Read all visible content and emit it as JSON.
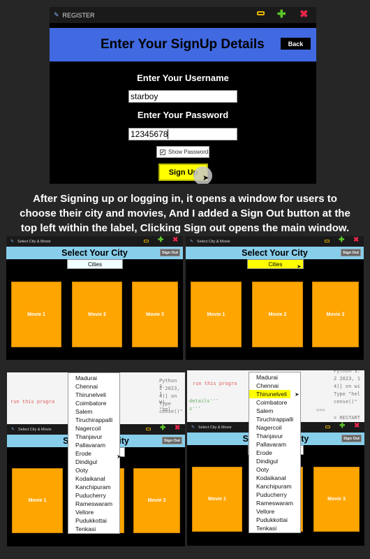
{
  "register": {
    "window_title": "REGISTER",
    "header_title": "Enter Your SignUp Details",
    "back_label": "Back",
    "username_label": "Enter Your Username",
    "username_value": "starboy",
    "password_label": "Enter Your Password",
    "password_value": "12345678",
    "show_password_label": "Show Password",
    "show_password_checked": true,
    "signup_label": "Sign Up"
  },
  "caption": {
    "line1": "After Signing up or logging in, it opens a window for users to",
    "line2": "choose their city and movies, And I added a Sign Out button at the",
    "line3": "top left within the label, Clicking Sign out opens the main window."
  },
  "city_window": {
    "window_title": "Select City & Movie",
    "header_title": "Select Your City",
    "signout_label": "Sign Out",
    "cities_label": "Cities",
    "movies": [
      "Movie 1",
      "Movie 2",
      "Movie 3"
    ]
  },
  "cities": [
    "Madurai",
    "Chennai",
    "Thirunelveli",
    "Coimbatore",
    "Salem",
    "Tiruchirappalli",
    "Nagercoil",
    "Thanjavur",
    "Pallavaram",
    "Erode",
    "Dindigul",
    "Ooty",
    "Kodaikanal",
    "Kanchipuram",
    "Puducherry",
    "Rameswaram",
    "Vellore",
    "Pudukkottai",
    "Tenkasi"
  ],
  "highlighted_city": "Thirunelveli",
  "editor_text": {
    "code_a": "run this progra",
    "code_b": "details'''",
    "code_c": "s'''",
    "shell_1": "Python 3.",
    "shell_2": "2 2023, 1",
    "shell_3": "4)] on wi",
    "shell_4": "Type \"hel",
    "shell_5": "cense()\"",
    "prompt": ">>>",
    "restart": "= RESTART"
  },
  "colors": {
    "register_header": "#4169e1",
    "city_header": "#87ceeb",
    "movie": "#ffa500",
    "highlight": "#ffff00",
    "background": "#262626"
  }
}
